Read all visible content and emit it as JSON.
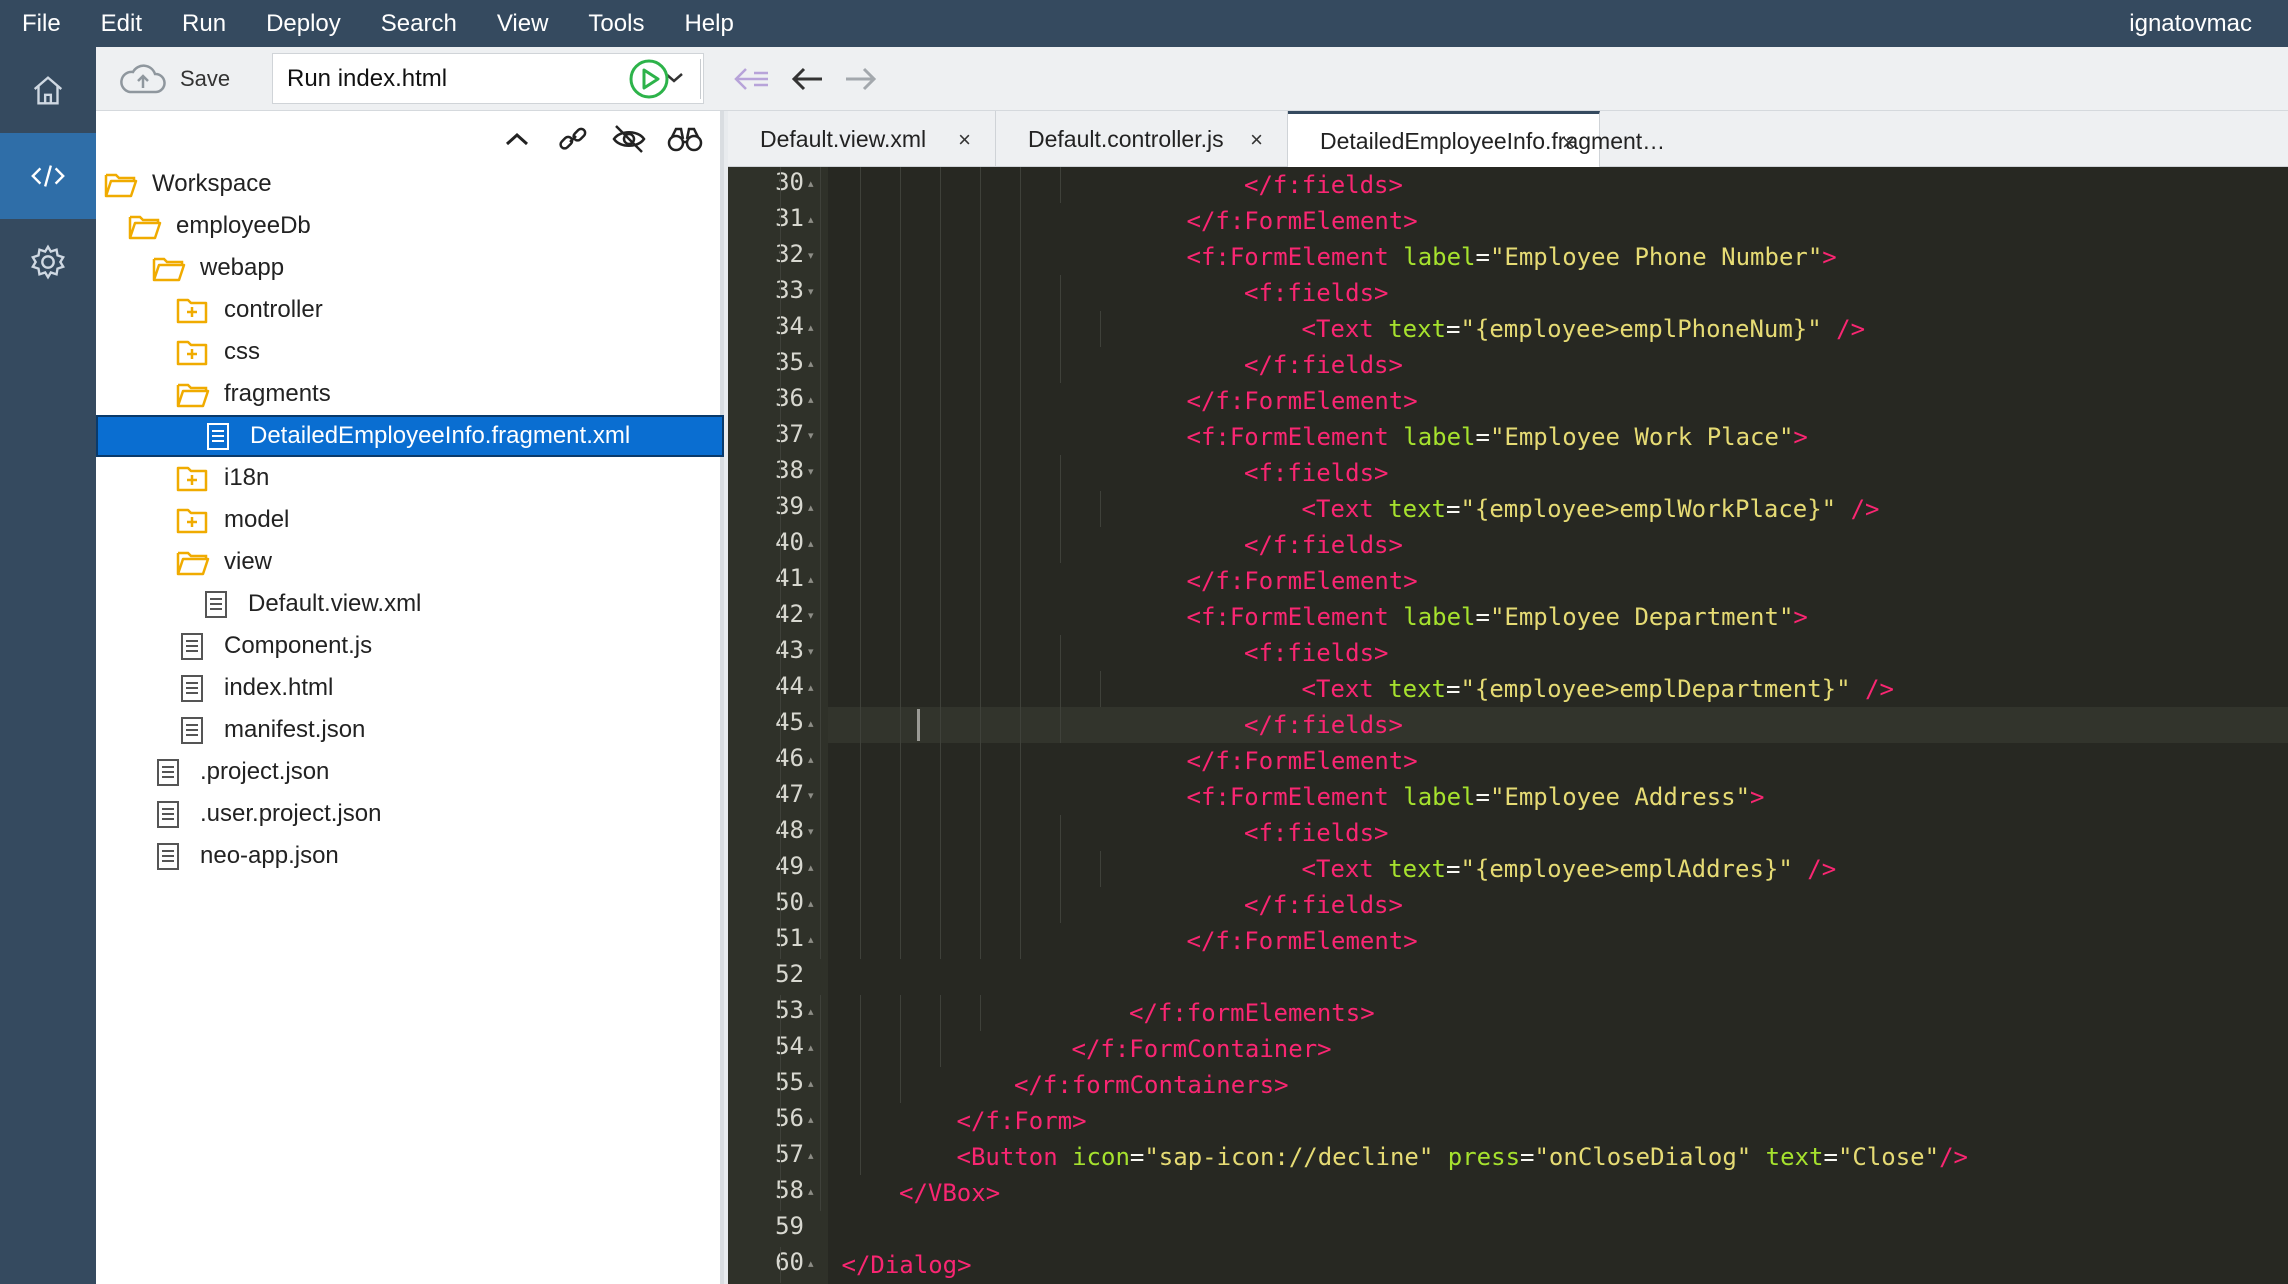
{
  "menu": [
    "File",
    "Edit",
    "Run",
    "Deploy",
    "Search",
    "View",
    "Tools",
    "Help"
  ],
  "user": "ignatovmac",
  "rail": [
    "home-icon",
    "code-icon",
    "settings-icon"
  ],
  "toolbar": {
    "save_label": "Save",
    "run_select_value": "Run index.html"
  },
  "explorer": {
    "tree": [
      {
        "label": "Workspace",
        "type": "folder-open",
        "depth": 0
      },
      {
        "label": "employeeDb",
        "type": "folder-open",
        "depth": 1
      },
      {
        "label": "webapp",
        "type": "folder-open",
        "depth": 2
      },
      {
        "label": "controller",
        "type": "folder-closed",
        "depth": 3
      },
      {
        "label": "css",
        "type": "folder-closed",
        "depth": 3
      },
      {
        "label": "fragments",
        "type": "folder-open",
        "depth": 3
      },
      {
        "label": "DetailedEmployeeInfo.fragment.xml",
        "type": "file",
        "depth": 4,
        "selected": true
      },
      {
        "label": "i18n",
        "type": "folder-closed",
        "depth": 3
      },
      {
        "label": "model",
        "type": "folder-closed",
        "depth": 3
      },
      {
        "label": "view",
        "type": "folder-open",
        "depth": 3
      },
      {
        "label": "Default.view.xml",
        "type": "file",
        "depth": 4
      },
      {
        "label": "Component.js",
        "type": "file",
        "depth": 3
      },
      {
        "label": "index.html",
        "type": "file",
        "depth": 3
      },
      {
        "label": "manifest.json",
        "type": "file",
        "depth": 3
      },
      {
        "label": ".project.json",
        "type": "file",
        "depth": 2
      },
      {
        "label": ".user.project.json",
        "type": "file",
        "depth": 2
      },
      {
        "label": "neo-app.json",
        "type": "file",
        "depth": 2
      }
    ]
  },
  "tabs": [
    {
      "label": "Default.view.xml",
      "close": "×"
    },
    {
      "label": "Default.controller.js",
      "close": "×"
    },
    {
      "label": "DetailedEmployeeInfo.fragment…",
      "close": "×",
      "active": true
    }
  ],
  "editor": {
    "current_line": 45,
    "lines": [
      {
        "n": "30",
        "indent": 8,
        "code": [
          [
            "tag",
            "</f:fields>"
          ]
        ]
      },
      {
        "n": "31",
        "indent": 7,
        "code": [
          [
            "tag",
            "</f:FormElement>"
          ]
        ]
      },
      {
        "n": "32",
        "indent": 7,
        "code": [
          [
            "tag",
            "<f:FormElement "
          ],
          [
            "attr",
            "label"
          ],
          [
            "eq",
            "="
          ],
          [
            "str",
            "\"Employee Phone Number\""
          ],
          [
            "tag",
            ">"
          ]
        ]
      },
      {
        "n": "33",
        "indent": 8,
        "code": [
          [
            "tag",
            "<f:fields>"
          ]
        ]
      },
      {
        "n": "34",
        "indent": 9,
        "code": [
          [
            "tag",
            "<Text "
          ],
          [
            "attr",
            "text"
          ],
          [
            "eq",
            "="
          ],
          [
            "str",
            "\"{employee>emplPhoneNum}\""
          ],
          [
            "tag",
            " />"
          ]
        ]
      },
      {
        "n": "35",
        "indent": 8,
        "code": [
          [
            "tag",
            "</f:fields>"
          ]
        ]
      },
      {
        "n": "36",
        "indent": 7,
        "code": [
          [
            "tag",
            "</f:FormElement>"
          ]
        ]
      },
      {
        "n": "37",
        "indent": 7,
        "code": [
          [
            "tag",
            "<f:FormElement "
          ],
          [
            "attr",
            "label"
          ],
          [
            "eq",
            "="
          ],
          [
            "str",
            "\"Employee Work Place\""
          ],
          [
            "tag",
            ">"
          ]
        ]
      },
      {
        "n": "38",
        "indent": 8,
        "code": [
          [
            "tag",
            "<f:fields>"
          ]
        ]
      },
      {
        "n": "39",
        "indent": 9,
        "code": [
          [
            "tag",
            "<Text "
          ],
          [
            "attr",
            "text"
          ],
          [
            "eq",
            "="
          ],
          [
            "str",
            "\"{employee>emplWorkPlace}\""
          ],
          [
            "tag",
            " />"
          ]
        ]
      },
      {
        "n": "40",
        "indent": 8,
        "code": [
          [
            "tag",
            "</f:fields>"
          ]
        ]
      },
      {
        "n": "41",
        "indent": 7,
        "code": [
          [
            "tag",
            "</f:FormElement>"
          ]
        ]
      },
      {
        "n": "42",
        "indent": 7,
        "code": [
          [
            "tag",
            "<f:FormElement "
          ],
          [
            "attr",
            "label"
          ],
          [
            "eq",
            "="
          ],
          [
            "str",
            "\"Employee Department\""
          ],
          [
            "tag",
            ">"
          ]
        ]
      },
      {
        "n": "43",
        "indent": 8,
        "code": [
          [
            "tag",
            "<f:fields>"
          ]
        ]
      },
      {
        "n": "44",
        "indent": 9,
        "code": [
          [
            "tag",
            "<Text "
          ],
          [
            "attr",
            "text"
          ],
          [
            "eq",
            "="
          ],
          [
            "str",
            "\"{employee>emplDepartment}\""
          ],
          [
            "tag",
            " />"
          ]
        ]
      },
      {
        "n": "45",
        "indent": 8,
        "code": [
          [
            "tag",
            "</f:fields>"
          ]
        ]
      },
      {
        "n": "46",
        "indent": 7,
        "code": [
          [
            "tag",
            "</f:FormElement>"
          ]
        ]
      },
      {
        "n": "47",
        "indent": 7,
        "code": [
          [
            "tag",
            "<f:FormElement "
          ],
          [
            "attr",
            "label"
          ],
          [
            "eq",
            "="
          ],
          [
            "str",
            "\"Employee Address\""
          ],
          [
            "tag",
            ">"
          ]
        ]
      },
      {
        "n": "48",
        "indent": 8,
        "code": [
          [
            "tag",
            "<f:fields>"
          ]
        ]
      },
      {
        "n": "49",
        "indent": 9,
        "code": [
          [
            "tag",
            "<Text "
          ],
          [
            "attr",
            "text"
          ],
          [
            "eq",
            "="
          ],
          [
            "str",
            "\"{employee>emplAddres}\""
          ],
          [
            "tag",
            " />"
          ]
        ]
      },
      {
        "n": "50",
        "indent": 8,
        "code": [
          [
            "tag",
            "</f:fields>"
          ]
        ]
      },
      {
        "n": "51",
        "indent": 7,
        "code": [
          [
            "tag",
            "</f:FormElement>"
          ]
        ]
      },
      {
        "n": "52",
        "indent": 0,
        "code": []
      },
      {
        "n": "53",
        "indent": 6,
        "code": [
          [
            "tag",
            "</f:formElements>"
          ]
        ]
      },
      {
        "n": "54",
        "indent": 5,
        "code": [
          [
            "tag",
            "</f:FormContainer>"
          ]
        ]
      },
      {
        "n": "55",
        "indent": 4,
        "code": [
          [
            "tag",
            "</f:formContainers>"
          ]
        ]
      },
      {
        "n": "56",
        "indent": 3,
        "code": [
          [
            "tag",
            "</f:Form>"
          ]
        ]
      },
      {
        "n": "57",
        "indent": 3,
        "code": [
          [
            "tag",
            "<Button "
          ],
          [
            "attr",
            "icon"
          ],
          [
            "eq",
            "="
          ],
          [
            "str",
            "\"sap-icon://decline\""
          ],
          [
            "attr",
            " press"
          ],
          [
            "eq",
            "="
          ],
          [
            "str",
            "\"onCloseDialog\""
          ],
          [
            "attr",
            " text"
          ],
          [
            "eq",
            "="
          ],
          [
            "str",
            "\"Close\""
          ],
          [
            "tag",
            "/>"
          ]
        ]
      },
      {
        "n": "58",
        "indent": 2,
        "code": [
          [
            "tag",
            "</VBox>"
          ]
        ]
      },
      {
        "n": "59",
        "indent": 0,
        "code": []
      },
      {
        "n": "60",
        "indent": 1,
        "code": [
          [
            "tag",
            "</Dialog>"
          ]
        ]
      }
    ]
  },
  "colors": {
    "menubar": "#354a5f",
    "selection": "#0a6ed1",
    "editor_bg": "#272822",
    "tag": "#f92672",
    "attr": "#a6e22e",
    "string": "#e6db74",
    "folder": "#f0ab00"
  }
}
